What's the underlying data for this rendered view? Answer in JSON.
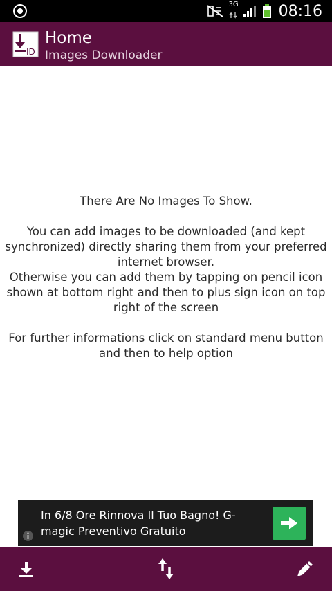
{
  "status_bar": {
    "time": "08:16",
    "network": "3G",
    "icons": [
      "notification-icon",
      "no-sim-icon",
      "signal-icon",
      "battery-icon"
    ]
  },
  "action_bar": {
    "title": "Home",
    "subtitle": "Images Downloader",
    "icon": "app-logo-icon",
    "logo_text": "ID"
  },
  "content": {
    "heading": "There Are No Images To Show.",
    "paragraph1": "You can add images to be downloaded (and kept synchronized) directly sharing them from your preferred internet browser.",
    "paragraph2": "Otherwise you can add them by tapping on pencil icon shown at bottom right and then to plus sign icon on top right of the screen",
    "paragraph3": "For further informations click on standard menu button and then to help option"
  },
  "ad": {
    "text": "In 6/8 Ore Rinnova Il Tuo Bagno! G-magic Preventivo Gratuito",
    "button_icon": "arrow-right-icon",
    "info_icon": "info-icon",
    "button_color": "#2db35a"
  },
  "bottom_bar": {
    "buttons": [
      "download-icon",
      "sync-icon",
      "pencil-icon"
    ]
  },
  "colors": {
    "primary": "#5b0f3f",
    "status_bar": "#000000",
    "ad_background": "#1c1c1c"
  }
}
